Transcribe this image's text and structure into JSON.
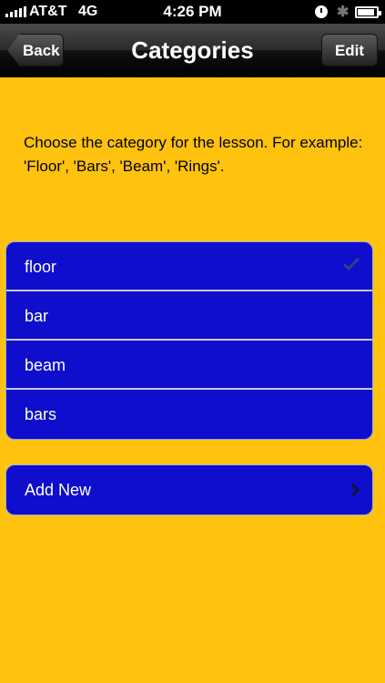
{
  "status_bar": {
    "carrier": "AT&T",
    "network": "4G",
    "time": "4:26 PM",
    "icons": [
      "signal-icon",
      "alarm-icon",
      "bluetooth-icon",
      "battery-icon"
    ]
  },
  "nav": {
    "back_label": "Back",
    "title": "Categories",
    "edit_label": "Edit"
  },
  "instructions": "Choose the category for the lesson.  For example: 'Floor', 'Bars', 'Beam', 'Rings'.",
  "categories": [
    {
      "label": "floor",
      "selected": true
    },
    {
      "label": "bar",
      "selected": false
    },
    {
      "label": "beam",
      "selected": false
    },
    {
      "label": "bars",
      "selected": false
    }
  ],
  "add_new_label": "Add New",
  "colors": {
    "background": "#FFC20F",
    "row": "#0E0ECC",
    "accent_check": "#3A3A8A"
  }
}
